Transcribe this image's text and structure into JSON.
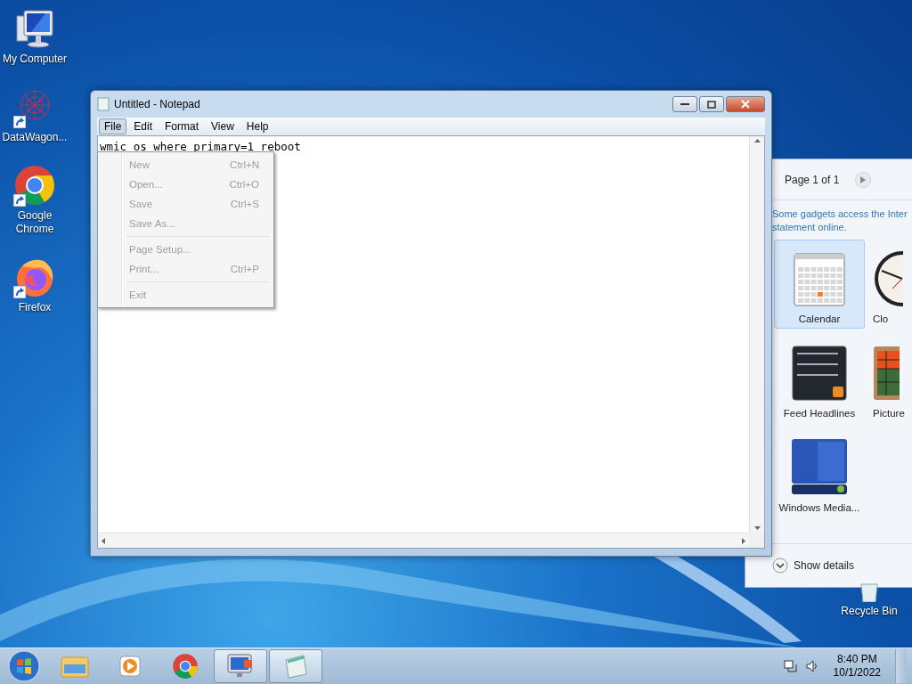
{
  "desktop_icons": [
    {
      "kind": "computer",
      "label": "My Computer",
      "shortcut": false
    },
    {
      "kind": "datawagon",
      "label": "DataWagon...",
      "shortcut": true
    },
    {
      "kind": "chrome",
      "label": "Google Chrome",
      "shortcut": true
    },
    {
      "kind": "firefox",
      "label": "Firefox",
      "shortcut": true
    }
  ],
  "recycle_bin": {
    "label": "Recycle Bin"
  },
  "gadgets": {
    "page": "Page 1 of 1",
    "notice": [
      "Some gadgets access the Inter",
      "statement online."
    ],
    "items": [
      {
        "kind": "calendar",
        "label": "Calendar",
        "selected": true
      },
      {
        "kind": "clock",
        "label": "Clo",
        "selected": false
      },
      {
        "kind": "feed",
        "label": "Feed Headlines",
        "selected": false
      },
      {
        "kind": "picture",
        "label": "Picture",
        "selected": false
      },
      {
        "kind": "media",
        "label": "Windows Media...",
        "selected": false
      }
    ],
    "show_details": "Show details"
  },
  "notepad": {
    "title": "Untitled - Notepad",
    "menu": [
      {
        "label": "File",
        "selected": true
      },
      {
        "label": "Edit",
        "selected": false
      },
      {
        "label": "Format",
        "selected": false
      },
      {
        "label": "View",
        "selected": false
      },
      {
        "label": "Help",
        "selected": false
      }
    ],
    "content": "wmic os where primary=1 reboot",
    "file_menu": [
      {
        "kind": "item",
        "label": "New",
        "shortcut": "Ctrl+N",
        "disabled": true
      },
      {
        "kind": "item",
        "label": "Open...",
        "shortcut": "Ctrl+O",
        "disabled": true
      },
      {
        "kind": "item",
        "label": "Save",
        "shortcut": "Ctrl+S",
        "disabled": true
      },
      {
        "kind": "item",
        "label": "Save As...",
        "disabled": true
      },
      {
        "kind": "separator"
      },
      {
        "kind": "item",
        "label": "Page Setup...",
        "disabled": true
      },
      {
        "kind": "item",
        "label": "Print...",
        "shortcut": "Ctrl+P",
        "disabled": true
      },
      {
        "kind": "separator"
      },
      {
        "kind": "item",
        "label": "Exit",
        "disabled": true
      }
    ]
  },
  "taskbar": {
    "buttons": [
      {
        "kind": "explorer",
        "active": false
      },
      {
        "kind": "media-player",
        "active": false
      },
      {
        "kind": "chrome",
        "active": false
      },
      {
        "kind": "computer",
        "active": true
      },
      {
        "kind": "notepad",
        "active": true
      }
    ],
    "time": "8:40 PM",
    "date": "10/1/2022"
  }
}
